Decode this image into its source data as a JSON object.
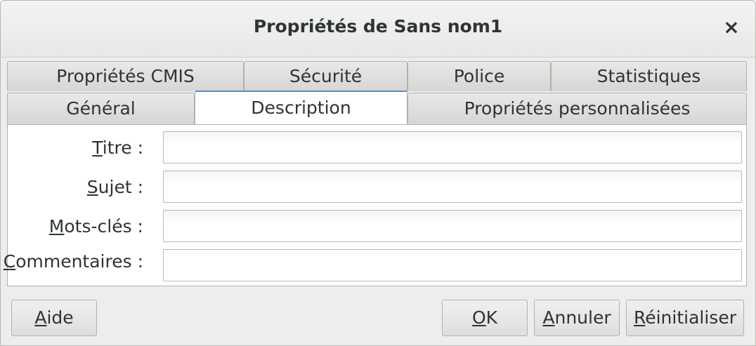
{
  "window": {
    "title": "Propriétés de Sans nom1",
    "close_icon": "×"
  },
  "tabs": {
    "row1": [
      {
        "label": "Propriétés CMIS"
      },
      {
        "label": "Sécurité"
      },
      {
        "label": "Police"
      },
      {
        "label": "Statistiques"
      }
    ],
    "row2": [
      {
        "label": "Général"
      },
      {
        "label": "Description",
        "active": true
      },
      {
        "label": "Propriétés personnalisées"
      }
    ]
  },
  "form": {
    "titre": {
      "mnemonic": "T",
      "rest": "itre :",
      "value": ""
    },
    "sujet": {
      "mnemonic": "S",
      "rest": "ujet :",
      "value": ""
    },
    "mots_cles": {
      "mnemonic": "M",
      "rest": "ots-clés :",
      "value": ""
    },
    "commentaires": {
      "mnemonic": "C",
      "rest": "ommentaires :",
      "value": ""
    }
  },
  "buttons": {
    "aide": {
      "mnemonic": "A",
      "rest": "ide"
    },
    "ok": {
      "mnemonic": "O",
      "rest": "K"
    },
    "annuler": {
      "mnemonic": "A",
      "rest": "nnuler"
    },
    "reinitialiser": {
      "mnemonic": "R",
      "rest": "éinitialiser"
    }
  },
  "colors": {
    "accent": "#4a90d9",
    "background": "#ededed",
    "text": "#2e3436"
  }
}
